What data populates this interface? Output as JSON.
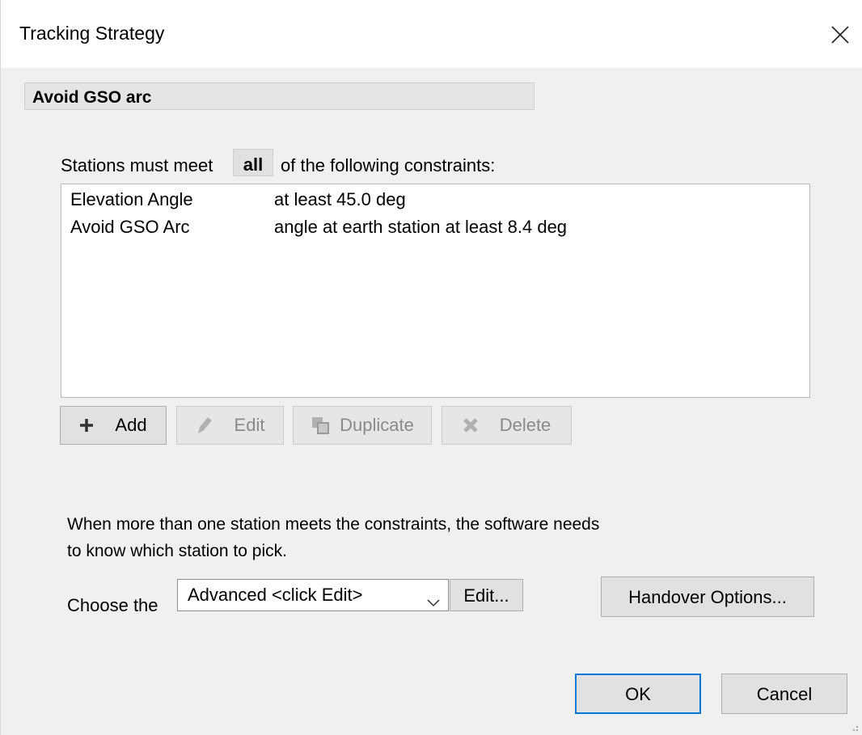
{
  "window": {
    "title": "Tracking Strategy",
    "close_icon": "close-icon"
  },
  "strategy": {
    "name": "Avoid GSO arc"
  },
  "constraints": {
    "prefix": "Stations must meet",
    "mode": "all",
    "suffix": "of the following constraints:",
    "rows": [
      {
        "name": "Elevation Angle",
        "condition": "at least 45.0 deg"
      },
      {
        "name": "Avoid GSO Arc",
        "condition": "angle at earth station at least 8.4 deg"
      }
    ]
  },
  "list_buttons": {
    "add": "Add",
    "edit": "Edit",
    "duplicate": "Duplicate",
    "delete": "Delete"
  },
  "selection": {
    "info_line1": "When more than one station meets the constraints, the software needs",
    "info_line2": "to know which station to pick.",
    "choose_label": "Choose the",
    "method_value": "Advanced <click Edit>",
    "edit_button": "Edit...",
    "handover_button": "Handover Options..."
  },
  "footer": {
    "ok": "OK",
    "cancel": "Cancel"
  },
  "colors": {
    "accent": "#0078d7",
    "disabled_text": "#8a8a8a"
  }
}
